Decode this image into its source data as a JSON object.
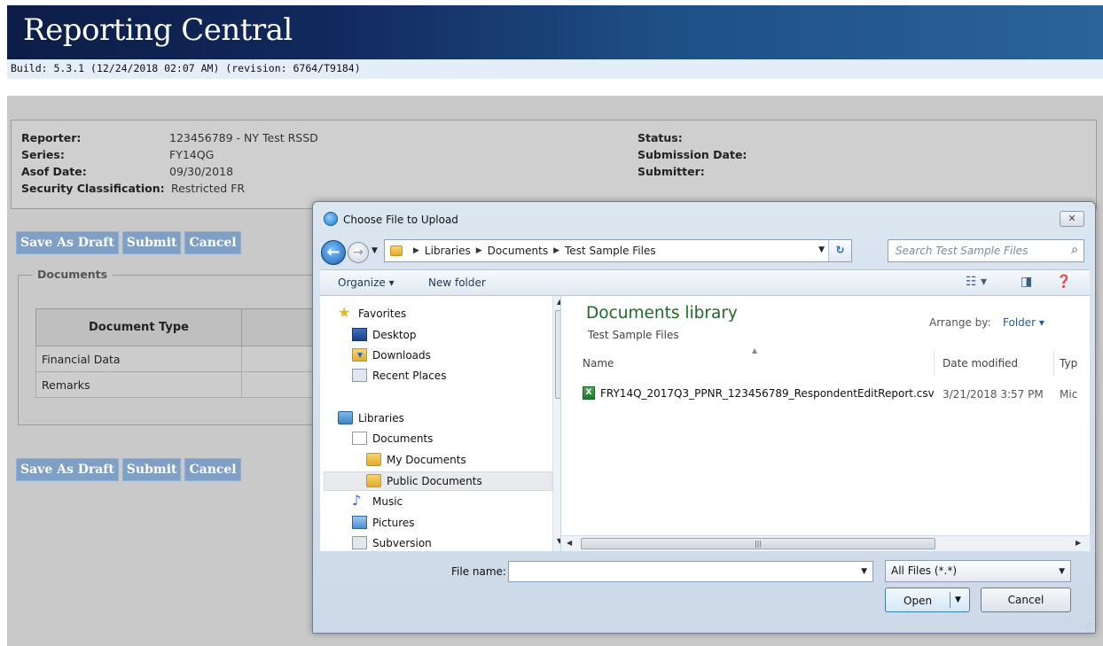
{
  "app": {
    "title": "Reporting Central",
    "build": "Build: 5.3.1 (12/24/2018 02:07 AM) (revision: 6764/T9184)"
  },
  "report_info": {
    "reporter_label": "Reporter:",
    "reporter_value": "123456789 - NY Test RSSD",
    "series_label": "Series:",
    "series_value": "FY14QG",
    "asof_label": "Asof Date:",
    "asof_value": "09/30/2018",
    "security_label": "Security Classification:",
    "security_value": "Restricted FR",
    "status_label": "Status:",
    "submission_label": "Submission Date:",
    "submitter_label": "Submitter:"
  },
  "actions": {
    "save_draft": "Save As Draft",
    "submit": "Submit",
    "cancel": "Cancel"
  },
  "documents": {
    "legend": "Documents",
    "header": "Document Type",
    "rows": [
      "Financial Data",
      "Remarks"
    ]
  },
  "dialog": {
    "title": "Choose File to Upload",
    "close": "✕",
    "breadcrumb": [
      "Libraries",
      "Documents",
      "Test Sample Files"
    ],
    "search_placeholder": "Search Test Sample Files",
    "toolbar": {
      "organize": "Organize ▾",
      "new_folder": "New folder"
    },
    "nav": {
      "favorites": "Favorites",
      "desktop": "Desktop",
      "downloads": "Downloads",
      "recent": "Recent Places",
      "libraries": "Libraries",
      "documents": "Documents",
      "my_documents": "My Documents",
      "public_documents": "Public Documents",
      "music": "Music",
      "pictures": "Pictures",
      "subversion": "Subversion"
    },
    "content": {
      "library_title": "Documents library",
      "library_subtitle": "Test Sample Files",
      "arrange_label": "Arrange by:",
      "arrange_value": "Folder ▾",
      "col_name": "Name",
      "col_date": "Date modified",
      "col_type": "Typ",
      "files": [
        {
          "name": "FRY14Q_2017Q3_PPNR_123456789_RespondentEditReport.csv",
          "date": "3/21/2018 3:57 PM",
          "type": "Mic"
        }
      ]
    },
    "filename_label": "File name:",
    "filename_value": "",
    "filetype_value": "All Files (*.*)",
    "open_label": "Open",
    "cancel_label": "Cancel"
  }
}
